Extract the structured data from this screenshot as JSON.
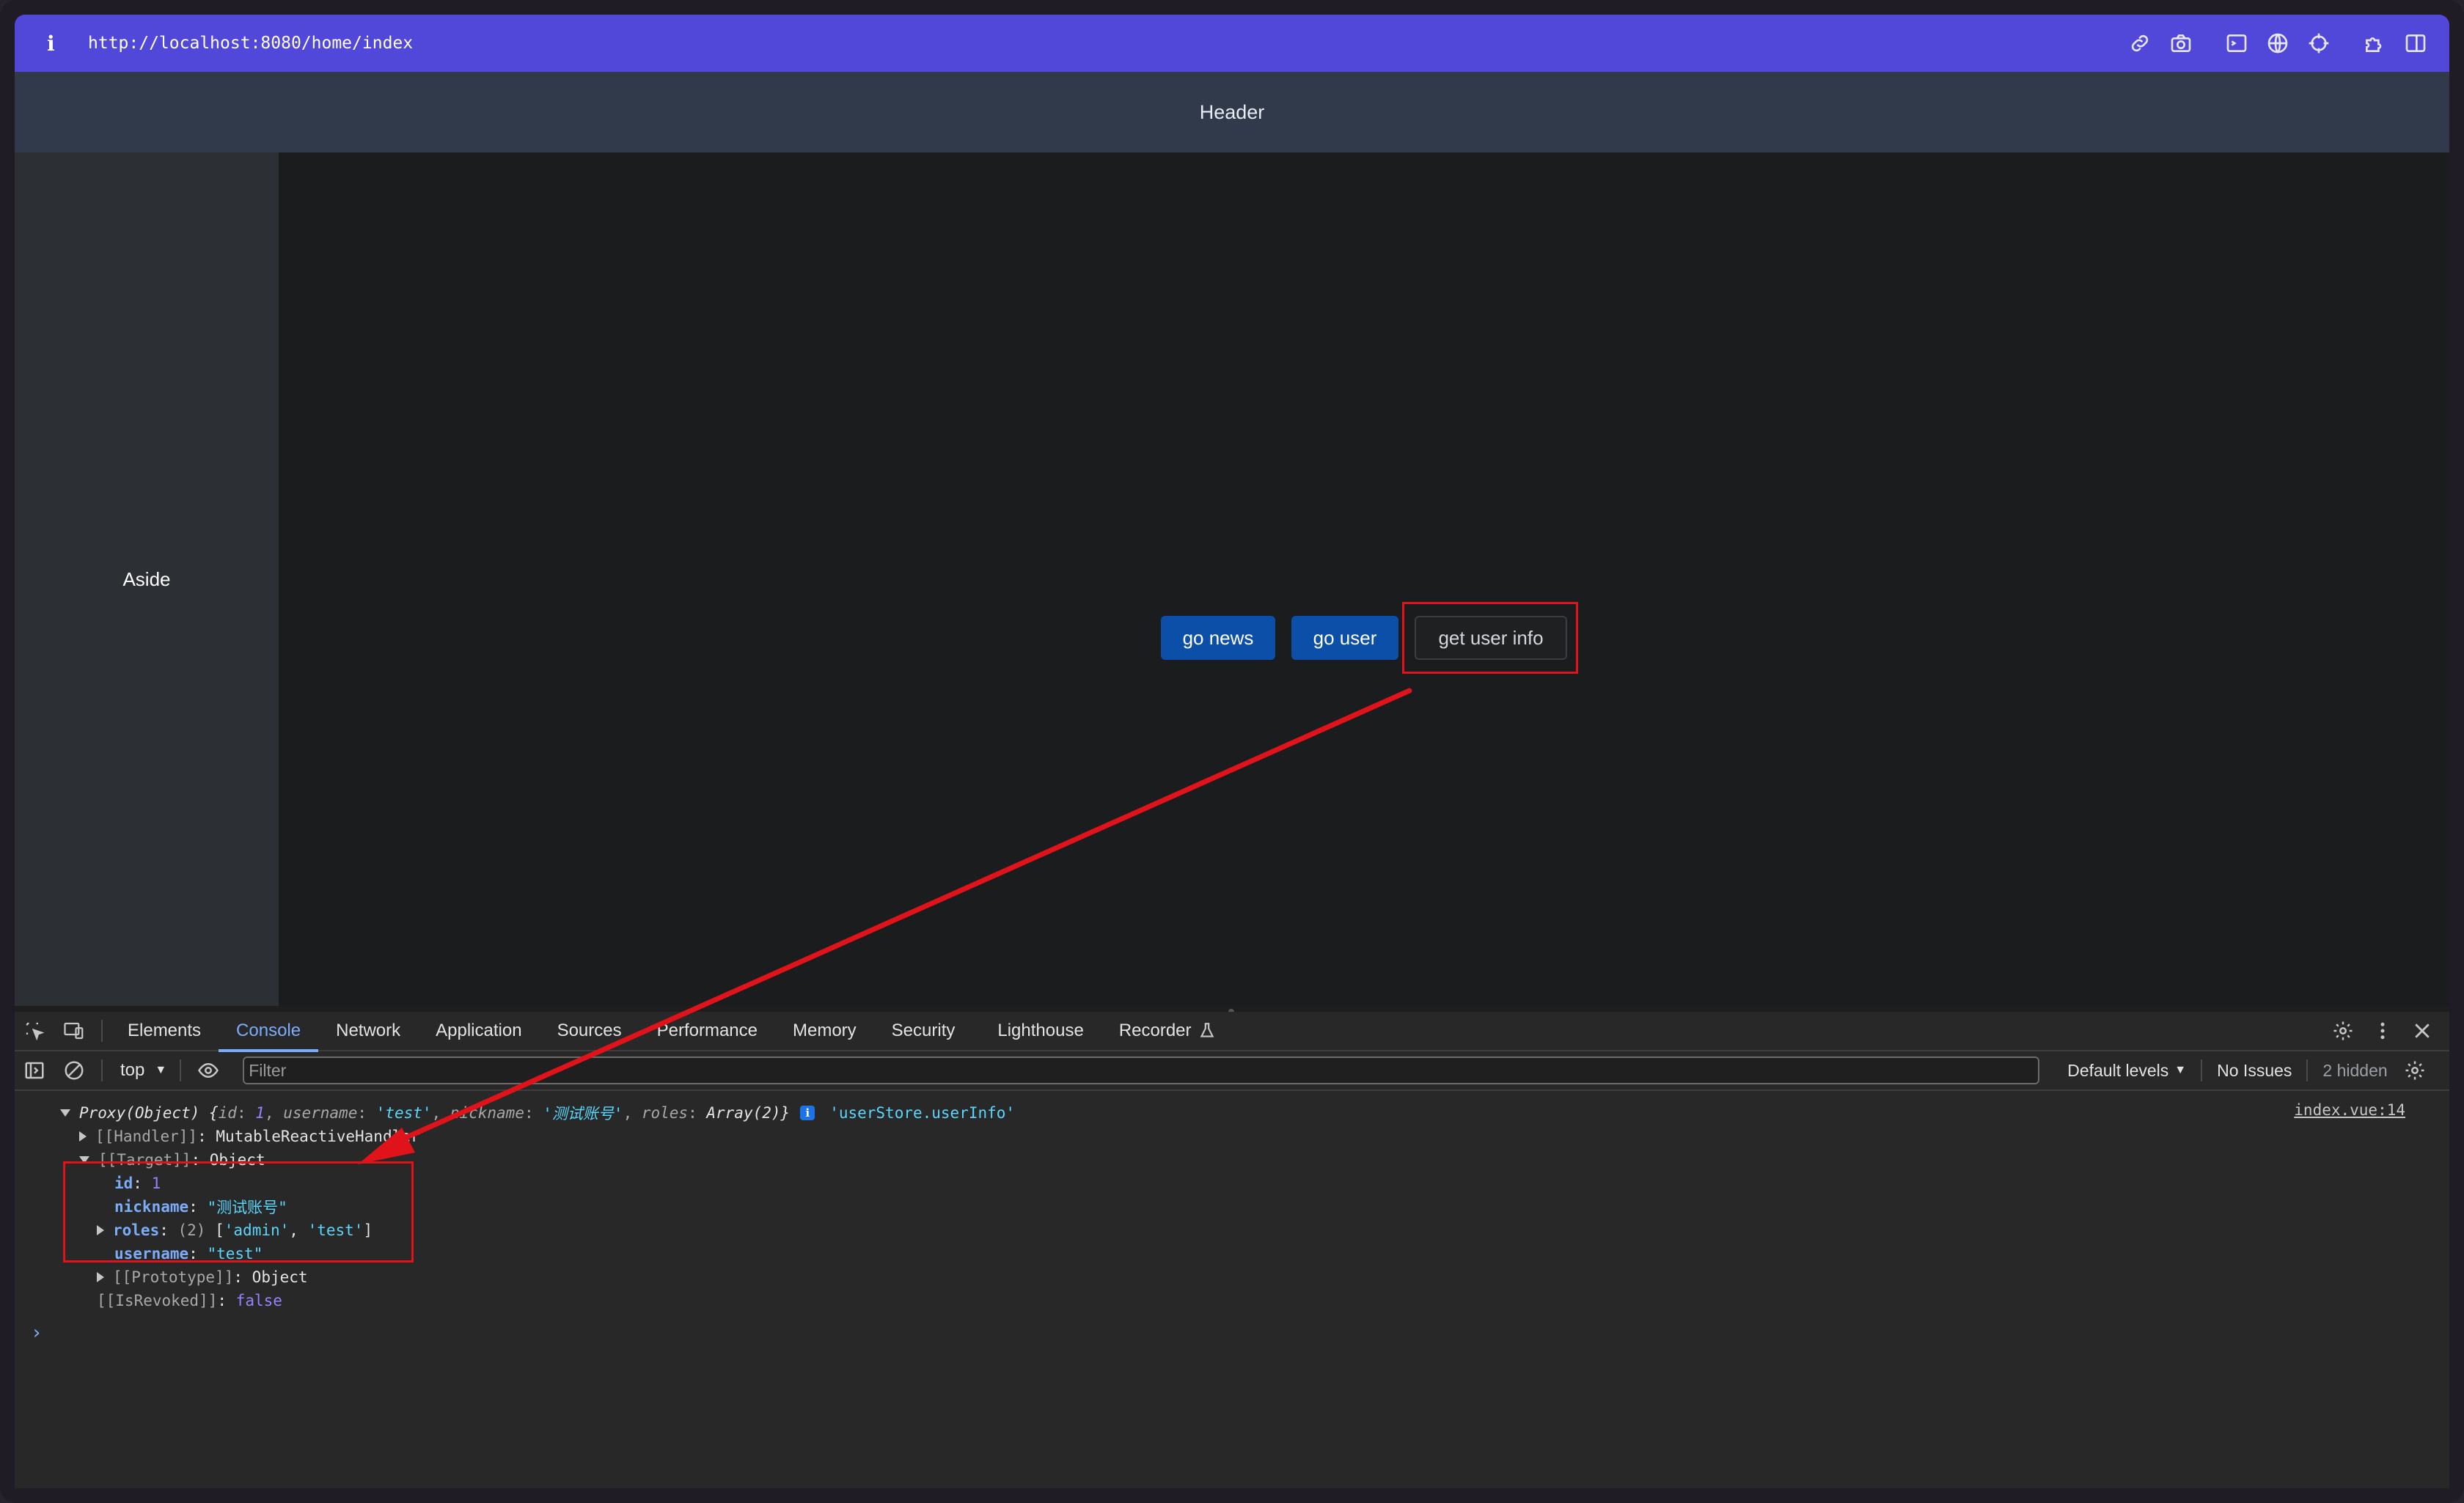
{
  "browser": {
    "url": "http://localhost:8080/home/index",
    "info_glyph": "i",
    "toolbar_icons": [
      "link-icon",
      "camera-icon",
      "terminal-icon",
      "globe-icon",
      "crosshair-icon",
      "puzzle-icon",
      "split-view-icon"
    ]
  },
  "page": {
    "header": "Header",
    "aside": "Aside",
    "buttons": {
      "go_news": "go news",
      "go_user": "go user",
      "get_user_info": "get user info"
    }
  },
  "devtools": {
    "tabs": [
      "Elements",
      "Console",
      "Network",
      "Application",
      "Sources",
      "Performance",
      "Memory",
      "Security",
      "Lighthouse",
      "Recorder"
    ],
    "active_tab": "Console",
    "toolbar": {
      "context": "top",
      "filter_placeholder": "Filter",
      "levels": "Default levels",
      "issues": "No Issues",
      "hidden": "2 hidden"
    },
    "console": {
      "source": "index.vue:14",
      "summary": {
        "prefix": "Proxy(Object) {",
        "id_key": "id",
        "id_val": "1",
        "username_key": "username",
        "username_val": "'test'",
        "nickname_key": "nickname",
        "nickname_val": "'测试账号'",
        "roles_key": "roles",
        "roles_val": "Array(2)",
        "suffix": "}",
        "label": "'userStore.userInfo'"
      },
      "handler": {
        "key": "[[Handler]]",
        "val": "MutableReactiveHandler"
      },
      "target": {
        "key": "[[Target]]",
        "val": "Object"
      },
      "id": {
        "key": "id",
        "val": "1"
      },
      "nickname": {
        "key": "nickname",
        "val": "\"测试账号\""
      },
      "roles": {
        "key": "roles",
        "count": "(2)",
        "open": "[",
        "a": "'admin'",
        "b": "'test'",
        "close": "]"
      },
      "username": {
        "key": "username",
        "val": "\"test\""
      },
      "prototype": {
        "key": "[[Prototype]]",
        "val": "Object"
      },
      "revoked": {
        "key": "[[IsRevoked]]",
        "val": "false"
      },
      "prompt": "›"
    }
  },
  "colors": {
    "url_bar": "#5147d8",
    "primary_button": "#0b4fa9",
    "annotation_red": "#e0131b",
    "active_tab": "#7cacf8"
  }
}
